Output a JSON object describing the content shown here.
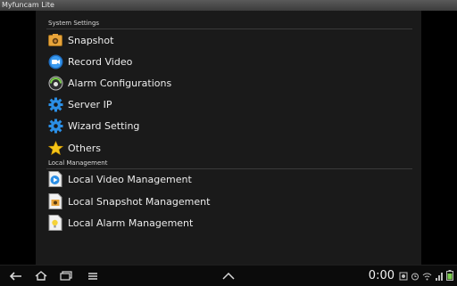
{
  "app": {
    "title": "Myfuncam Lite"
  },
  "sections": {
    "system": {
      "header": "System Settings",
      "items": [
        {
          "label": "Snapshot",
          "icon": "snapshot-icon"
        },
        {
          "label": "Record Video",
          "icon": "record-video-icon"
        },
        {
          "label": "Alarm Configurations",
          "icon": "alarm-icon"
        },
        {
          "label": "Server IP",
          "icon": "gear-icon"
        },
        {
          "label": "Wizard Setting",
          "icon": "gear-icon"
        },
        {
          "label": "Others",
          "icon": "star-icon"
        }
      ]
    },
    "local": {
      "header": "Local Management",
      "items": [
        {
          "label": "Local Video Management",
          "icon": "video-file-icon"
        },
        {
          "label": "Local Snapshot Management",
          "icon": "image-file-icon"
        },
        {
          "label": "Local Alarm Management",
          "icon": "alarm-file-icon"
        }
      ]
    }
  },
  "statusbar": {
    "time": "0:00"
  },
  "colors": {
    "accent_blue": "#2b8fe6",
    "star_yellow": "#f5c518",
    "panel": "#1a1a1a"
  }
}
